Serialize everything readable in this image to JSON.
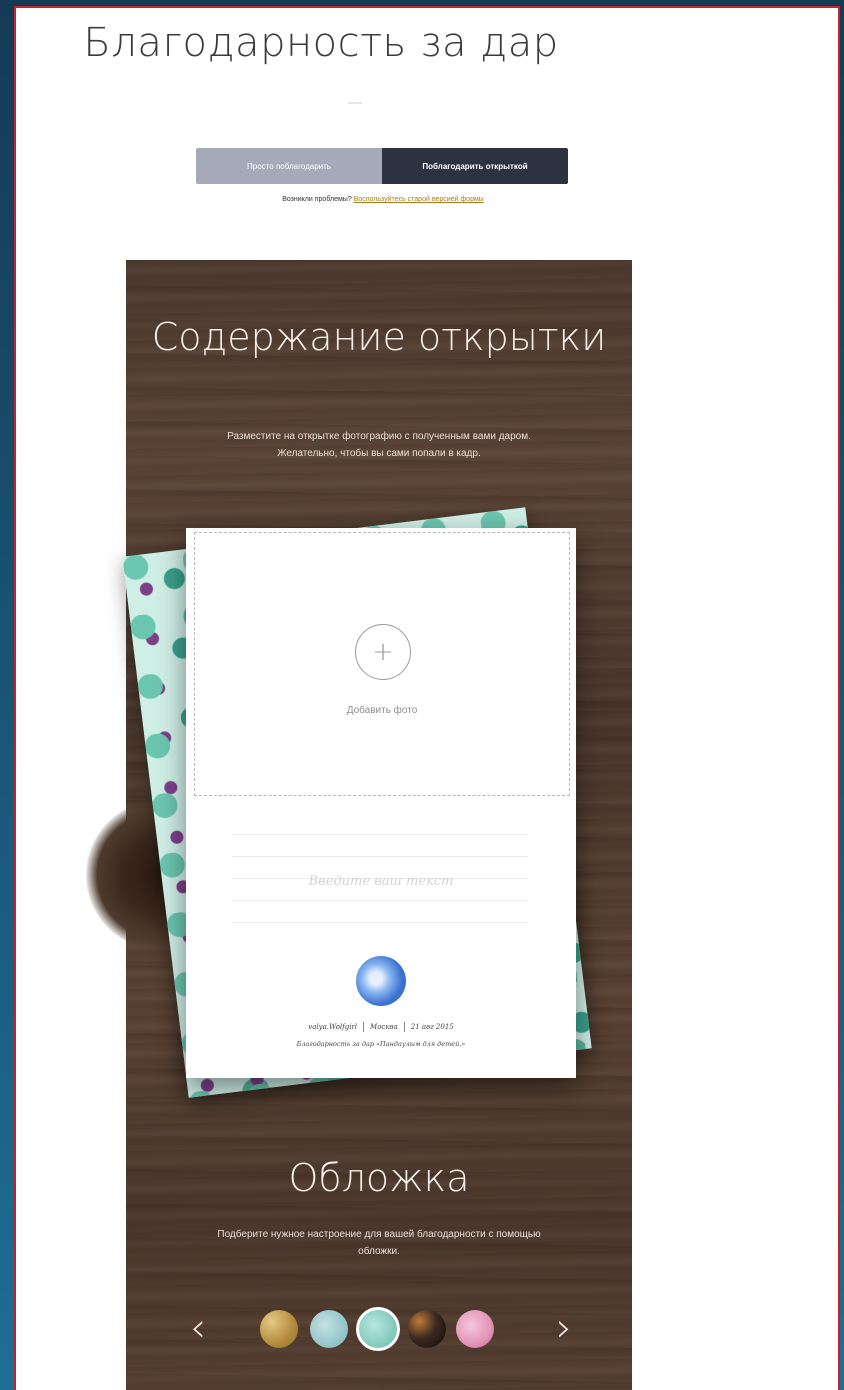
{
  "header": {
    "title": "Благодарность за дар"
  },
  "mode_switch": {
    "option_simple": "Просто поблагодарить",
    "option_card": "Поблагодарить открыткой"
  },
  "problem": {
    "prefix": "Возникли проблемы?",
    "link": "Воспользуйтесь старой версией формы"
  },
  "content_section": {
    "title": "Содержание открытки",
    "description": "Разместите на открытке фотографию с полученным вами даром. Желательно, чтобы вы сами попали в кадр."
  },
  "card": {
    "add_photo": "Добавить фото",
    "plus_symbol": "+",
    "text_placeholder": "Введите ваш текст",
    "signature": {
      "user": "valya.Wolfgirl",
      "city": "Москва",
      "date": "21 авг 2015"
    },
    "thanks_line": "Благодарность за дар «Пандаулым для детей.»"
  },
  "cover_section": {
    "title": "Обложка",
    "description": "Подберите нужное настроение для вашей благодарности с помощью обложки."
  },
  "cover_nav": {
    "prev": "‹",
    "next": "›"
  },
  "colors": {
    "accent_dark": "#2d3240",
    "accent_light": "#a5a9b8",
    "link": "#a97c1a",
    "frame": "#c8202a"
  }
}
